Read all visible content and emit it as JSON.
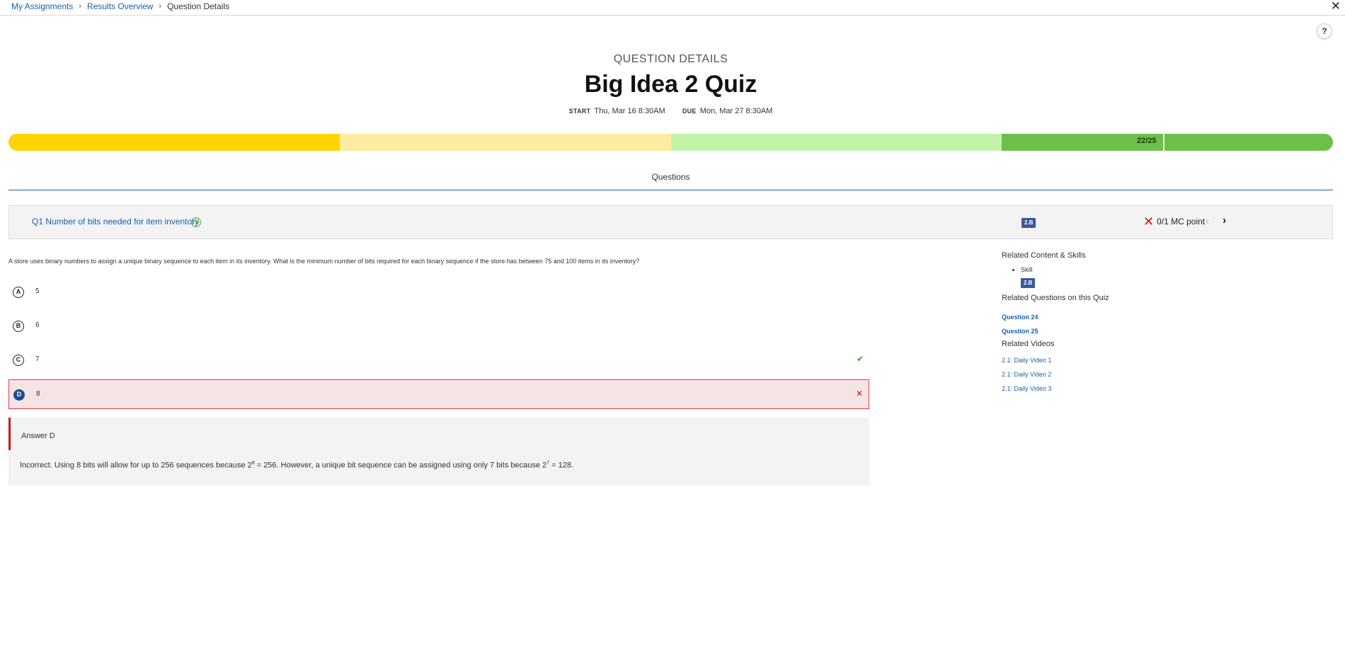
{
  "breadcrumb": {
    "items": [
      "My Assignments",
      "Results Overview"
    ],
    "current": "Question Details",
    "separator": "›"
  },
  "close_icon": "✕",
  "help_label": "?",
  "header": {
    "eyebrow": "QUESTION DETAILS",
    "title": "Big Idea 2 Quiz",
    "start_label": "START",
    "start_value": "Thu, Mar 16 8:30AM",
    "due_label": "DUE",
    "due_value": "Mon, Mar 27 8:30AM"
  },
  "progress": {
    "score_text": "22/25",
    "score": 22,
    "total": 25,
    "segment_colors": [
      "#ffd400",
      "#ffeca0",
      "#c1f4a8",
      "#6cc04a"
    ]
  },
  "tabs": {
    "questions": "Questions"
  },
  "question": {
    "title": "Q1 Number of bits needed for item inventory",
    "type_icon": "mc-question-icon",
    "skill": "2.B",
    "points_text": "0/1 MC point",
    "stem": "A store uses binary numbers to assign a unique binary sequence to each item in its inventory. What is the minimum number of bits required for each binary sequence if the store has between 75 and 100 items in its inventory?",
    "choices": [
      {
        "letter": "A",
        "text": "5"
      },
      {
        "letter": "B",
        "text": "6"
      },
      {
        "letter": "C",
        "text": "7",
        "correct": true
      },
      {
        "letter": "D",
        "text": "8",
        "selected": true
      }
    ],
    "answer_label": "Answer D",
    "explanation_pre": "Incorrect. Using 8 bits will allow for up to 256 sequences because ",
    "explanation_math1": "2",
    "explanation_exp1": "8",
    "explanation_eq1": " = 256",
    "explanation_mid": ". However, a unique bit sequence can be assigned using only 7 bits because ",
    "explanation_math2": "2",
    "explanation_exp2": "7",
    "explanation_eq2": " = 128",
    "explanation_post": "."
  },
  "sidebar": {
    "related_content_heading": "Related Content & Skills",
    "skill_item": "Skill",
    "skill_badge": "2.B",
    "related_questions_heading": "Related Questions on this Quiz",
    "related_questions": [
      "Question 24",
      "Question 25"
    ],
    "related_videos_heading": "Related Videos",
    "videos": [
      "2.1: Daily Video 1",
      "2.1: Daily Video 2",
      "2.1: Daily Video 3"
    ]
  },
  "colors": {
    "link": "#1a5fa8",
    "wrong": "#d0141b",
    "correct": "#3a9a2c",
    "skill_badge": "#3b5998"
  }
}
